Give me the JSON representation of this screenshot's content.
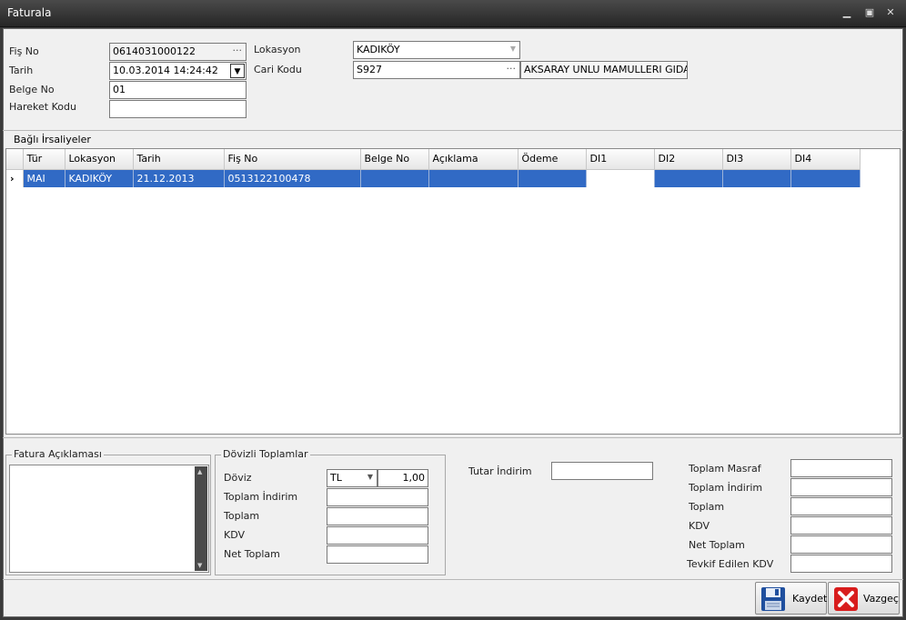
{
  "window": {
    "title": "Faturala"
  },
  "header": {
    "fis_no_label": "Fiş No",
    "fis_no": "0614031000122",
    "tarih_label": "Tarih",
    "tarih": "10.03.2014 14:24:42",
    "belge_no_label": "Belge No",
    "belge_no": "01",
    "hareket_kodu_label": "Hareket Kodu",
    "hareket_kodu": "",
    "lokasyon_label": "Lokasyon",
    "lokasyon": "KADIKÖY",
    "cari_kodu_label": "Cari Kodu",
    "cari_kodu": "S927",
    "cari_adi": "AKSARAY UNLU MAMULLERI GIDA ..."
  },
  "irsaliye": {
    "title": "Bağlı İrsaliyeler",
    "columns": [
      "Tür",
      "Lokasyon",
      "Tarih",
      "Fiş No",
      "Belge No",
      "Açıklama",
      "Ödeme",
      "DI1",
      "DI2",
      "DI3",
      "DI4"
    ],
    "rows": [
      [
        "MAI",
        "KADIKÖY",
        "21.12.2013",
        "0513122100478",
        "",
        "",
        "",
        "",
        "",
        "",
        ""
      ]
    ]
  },
  "aciklama": {
    "title": "Fatura Açıklaması"
  },
  "doviz": {
    "title": "Dövizli Toplamlar",
    "doviz_label": "Döviz",
    "doviz_value": "TL",
    "kur": "1,00",
    "toplam_indirim_label": "Toplam İndirim",
    "toplam_label": "Toplam",
    "kdv_label": "KDV",
    "net_toplam_label": "Net Toplam"
  },
  "tutar_indirim_label": "Tutar İndirim",
  "totals": {
    "toplam_masraf_label": "Toplam Masraf",
    "toplam_indirim_label": "Toplam İndirim",
    "toplam_label": "Toplam",
    "kdv_label": "KDV",
    "net_toplam_label": "Net Toplam",
    "tevkif_label": "Tevkif Edilen KDV"
  },
  "buttons": {
    "kaydet": "Kaydet",
    "vazgec": "Vazgeç"
  }
}
